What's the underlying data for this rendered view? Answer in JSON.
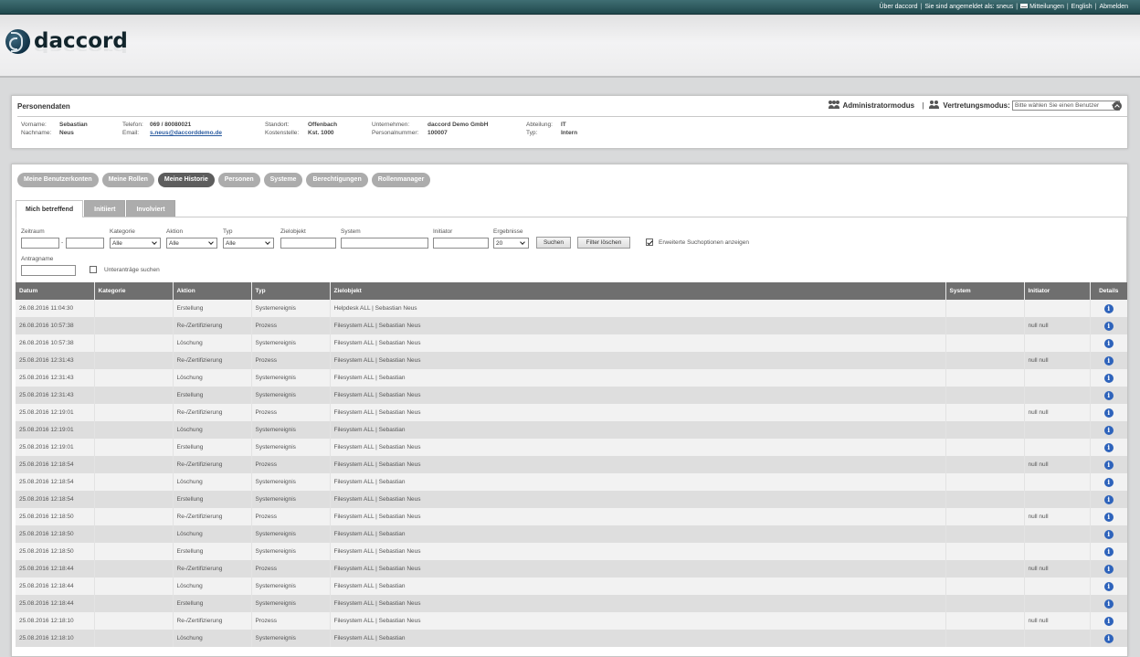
{
  "topbar": {
    "about": "Über daccord",
    "logged_in": "Sie sind angemeldet als: sneus",
    "messages": "Mitteilungen",
    "language": "English",
    "logout": "Abmelden"
  },
  "brand": {
    "name": "daccord"
  },
  "person_panel": {
    "title": "Personendaten",
    "admin_mode": "Administratormodus",
    "separator": "|",
    "substitute_mode": "Vertretungsmodus:",
    "substitute_select": "Bitte wählen Sie einen Benutzer",
    "fields": {
      "vorname_label": "Vorname:",
      "vorname": "Sebastian",
      "nachname_label": "Nachname:",
      "nachname": "Neus",
      "telefon_label": "Telefon:",
      "telefon": "069 / 80080021",
      "email_label": "Email:",
      "email": "s.neus@daccorddemo.de",
      "standort_label": "Standort:",
      "standort": "Offenbach",
      "kostenstelle_label": "Kostenstelle:",
      "kostenstelle": "Kst. 1000",
      "unternehmen_label": "Unternehmen:",
      "unternehmen": "daccord Demo GmbH",
      "personalnummer_label": "Personalnummer:",
      "personalnummer": "100007",
      "abteilung_label": "Abteilung:",
      "abteilung": "IT",
      "typ_label": "Typ:",
      "typ": "Intern"
    }
  },
  "main_tabs": [
    "Meine Benutzerkonten",
    "Meine Rollen",
    "Meine Historie",
    "Personen",
    "Systeme",
    "Berechtigungen",
    "Rollenmanager"
  ],
  "sub_tabs": [
    "Mich betreffend",
    "Initiiert",
    "Involviert"
  ],
  "filters": {
    "zeitraum": "Zeitraum",
    "zeitraum_sep": "-",
    "kategorie": "Kategorie",
    "kategorie_value": "Alle",
    "aktion": "Aktion",
    "aktion_value": "Alle",
    "typ": "Typ",
    "typ_value": "Alle",
    "zielobjekt": "Zielobjekt",
    "system": "System",
    "initiator": "Initiator",
    "ergebnisse": "Ergebnisse",
    "ergebnisse_value": "20",
    "suchen": "Suchen",
    "filter_loeschen": "Filter löschen",
    "erweitert": "Erweiterte Suchoptionen anzeigen",
    "antragname": "Antragname",
    "unterantraege": "Unteranträge suchen"
  },
  "table": {
    "headers": [
      "Datum",
      "Kategorie",
      "Aktion",
      "Typ",
      "Zielobjekt",
      "System",
      "Initiator",
      "Details"
    ],
    "rows": [
      [
        "26.08.2016 11:04:30",
        "",
        "Erstellung",
        "Systemereignis",
        "Helpdesk ALL | Sebastian Neus",
        "",
        ""
      ],
      [
        "26.08.2016 10:57:38",
        "",
        "Re-/Zertifizierung",
        "Prozess",
        "Filesystem ALL | Sebastian Neus",
        "",
        "null null"
      ],
      [
        "26.08.2016 10:57:38",
        "",
        "Löschung",
        "Systemereignis",
        "Filesystem ALL | Sebastian Neus",
        "",
        ""
      ],
      [
        "25.08.2016 12:31:43",
        "",
        "Re-/Zertifizierung",
        "Prozess",
        "Filesystem ALL | Sebastian Neus",
        "",
        "null null"
      ],
      [
        "25.08.2016 12:31:43",
        "",
        "Löschung",
        "Systemereignis",
        "Filesystem ALL | Sebastian",
        "",
        ""
      ],
      [
        "25.08.2016 12:31:43",
        "",
        "Erstellung",
        "Systemereignis",
        "Filesystem ALL | Sebastian Neus",
        "",
        ""
      ],
      [
        "25.08.2016 12:19:01",
        "",
        "Re-/Zertifizierung",
        "Prozess",
        "Filesystem ALL | Sebastian Neus",
        "",
        "null null"
      ],
      [
        "25.08.2016 12:19:01",
        "",
        "Löschung",
        "Systemereignis",
        "Filesystem ALL | Sebastian",
        "",
        ""
      ],
      [
        "25.08.2016 12:19:01",
        "",
        "Erstellung",
        "Systemereignis",
        "Filesystem ALL | Sebastian Neus",
        "",
        ""
      ],
      [
        "25.08.2016 12:18:54",
        "",
        "Re-/Zertifizierung",
        "Prozess",
        "Filesystem ALL | Sebastian Neus",
        "",
        "null null"
      ],
      [
        "25.08.2016 12:18:54",
        "",
        "Löschung",
        "Systemereignis",
        "Filesystem ALL | Sebastian",
        "",
        ""
      ],
      [
        "25.08.2016 12:18:54",
        "",
        "Erstellung",
        "Systemereignis",
        "Filesystem ALL | Sebastian Neus",
        "",
        ""
      ],
      [
        "25.08.2016 12:18:50",
        "",
        "Re-/Zertifizierung",
        "Prozess",
        "Filesystem ALL | Sebastian Neus",
        "",
        "null null"
      ],
      [
        "25.08.2016 12:18:50",
        "",
        "Löschung",
        "Systemereignis",
        "Filesystem ALL | Sebastian",
        "",
        ""
      ],
      [
        "25.08.2016 12:18:50",
        "",
        "Erstellung",
        "Systemereignis",
        "Filesystem ALL | Sebastian Neus",
        "",
        ""
      ],
      [
        "25.08.2016 12:18:44",
        "",
        "Re-/Zertifizierung",
        "Prozess",
        "Filesystem ALL | Sebastian Neus",
        "",
        "null null"
      ],
      [
        "25.08.2016 12:18:44",
        "",
        "Löschung",
        "Systemereignis",
        "Filesystem ALL | Sebastian",
        "",
        ""
      ],
      [
        "25.08.2016 12:18:44",
        "",
        "Erstellung",
        "Systemereignis",
        "Filesystem ALL | Sebastian Neus",
        "",
        ""
      ],
      [
        "25.08.2016 12:18:10",
        "",
        "Re-/Zertifizierung",
        "Prozess",
        "Filesystem ALL | Sebastian Neus",
        "",
        "null null"
      ],
      [
        "25.08.2016 12:18:10",
        "",
        "Löschung",
        "Systemereignis",
        "Filesystem ALL | Sebastian",
        "",
        ""
      ]
    ],
    "details_icon": "info-icon"
  },
  "colors": {
    "topbar": "#2c5c60",
    "tab_active": "#5d5d5d",
    "tab_inactive": "#acacac",
    "table_header": "#6f6f6f",
    "info_icon": "#2e63bb",
    "link": "#2a5b9f"
  }
}
